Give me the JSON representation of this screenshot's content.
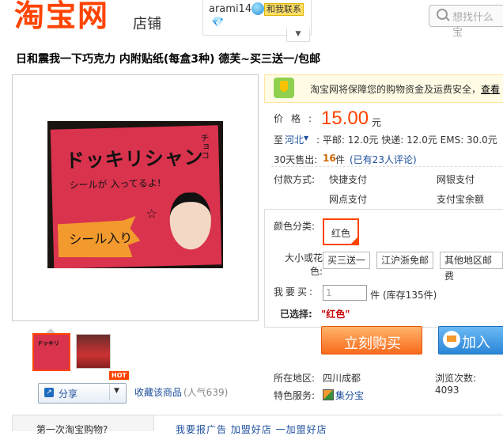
{
  "header": {
    "logo": "淘宝网",
    "logo_sub": "店铺",
    "seller_name": "arami14",
    "contact_label": "和我联系",
    "search_placeholder": "想找什么宝"
  },
  "product": {
    "title": "日和震我一下巧克力 内附贴纸(每盒3种) 德芙~买三送一/包邮",
    "image_text": {
      "line1": "ドッキリシャン",
      "line2": "シールが 入ってるよ!",
      "side": "チョコ",
      "burst": "シール入り"
    },
    "thumb_text": "ドッキリ"
  },
  "actions": {
    "share_label": "分享",
    "hot_badge": "HOT",
    "favorite_label": "收藏该商品",
    "popularity": "(人气639)"
  },
  "security": {
    "text": "淘宝网将保障您的购物资金及运费安全，",
    "link": "查看"
  },
  "price": {
    "label": "价格:",
    "value": "15.00",
    "unit": "元"
  },
  "shipping": {
    "to_label": "至",
    "region": "河北",
    "info": ": 平邮: 12.0元   快递: 12.0元   EMS: 30.0元"
  },
  "sales": {
    "label": "30天售出:",
    "count": "16",
    "unit": "件",
    "reviews": "(已有23人评论)"
  },
  "payment": {
    "label": "付款方式:",
    "methods": [
      "快捷支付",
      "网银支付",
      "网点支付",
      "支付宝余额"
    ]
  },
  "options": {
    "color_label": "颜色分类:",
    "color_selected": "红色",
    "size_label": "大小或花色:",
    "size_options": [
      "买三送一",
      "江沪浙免邮",
      "其他地区邮费"
    ],
    "qty_label": "我要买:",
    "qty_value": "1",
    "qty_unit": "件",
    "stock": "(库存135件)",
    "chosen_label": "已选择:",
    "chosen_value": "\"红色\""
  },
  "buttons": {
    "buy_now": "立刻购买",
    "add_to_cart": "加入购"
  },
  "meta": {
    "location_label": "所在地区:",
    "location_value": "四川成都",
    "views": "浏览次数: 4093",
    "service_label": "特色服务:",
    "service_value": "集分宝"
  },
  "bottom": {
    "tab": "第一次淘宝购物?",
    "links": "我要报广告    加盟好店    一加盟好店"
  }
}
